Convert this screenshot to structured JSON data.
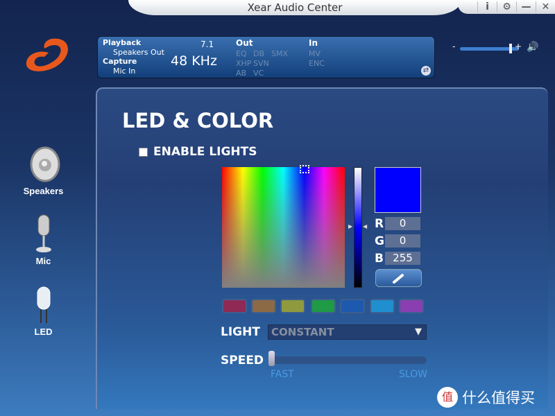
{
  "window": {
    "title": "Xear Audio Center",
    "buttons": [
      "i",
      "⚙",
      "—",
      "✕"
    ]
  },
  "sidebar": {
    "items": [
      {
        "label": "Speakers",
        "icon": "speaker-icon"
      },
      {
        "label": "Mic",
        "icon": "microphone-icon"
      },
      {
        "label": "LED",
        "icon": "led-icon"
      }
    ]
  },
  "info": {
    "playback": "Playback",
    "playback_dev": "Speakers Out",
    "capture": "Capture",
    "capture_dev": "Mic In",
    "channels": "7.1",
    "rate": "48 KHz",
    "out": "Out",
    "out_items": [
      "EQ",
      "DB",
      "SMX",
      "XHP",
      "SVN",
      "AB",
      "VC"
    ],
    "in": "In",
    "in_items": [
      "MV",
      "ENC"
    ]
  },
  "volume": {
    "minus": "-",
    "plus": "+",
    "level": 0.9
  },
  "main": {
    "title": "LED & COLOR",
    "enable_label": "ENABLE LIGHTS",
    "enabled": false,
    "color": {
      "hex": "#0000ff",
      "r_label": "R",
      "r": "0",
      "g_label": "G",
      "g": "0",
      "b_label": "B",
      "b": "255"
    },
    "swatches": [
      "#8e2a55",
      "#8c6a45",
      "#8f9a3f",
      "#1f9a45",
      "#1d5aaf",
      "#1f8fcf",
      "#8a3fb0"
    ],
    "light_label": "LIGHT",
    "light_value": "CONSTANT",
    "speed_label": "SPEED",
    "speed_fast": "FAST",
    "speed_slow": "SLOW",
    "speed_value": 0
  },
  "watermark": "什么值得买"
}
